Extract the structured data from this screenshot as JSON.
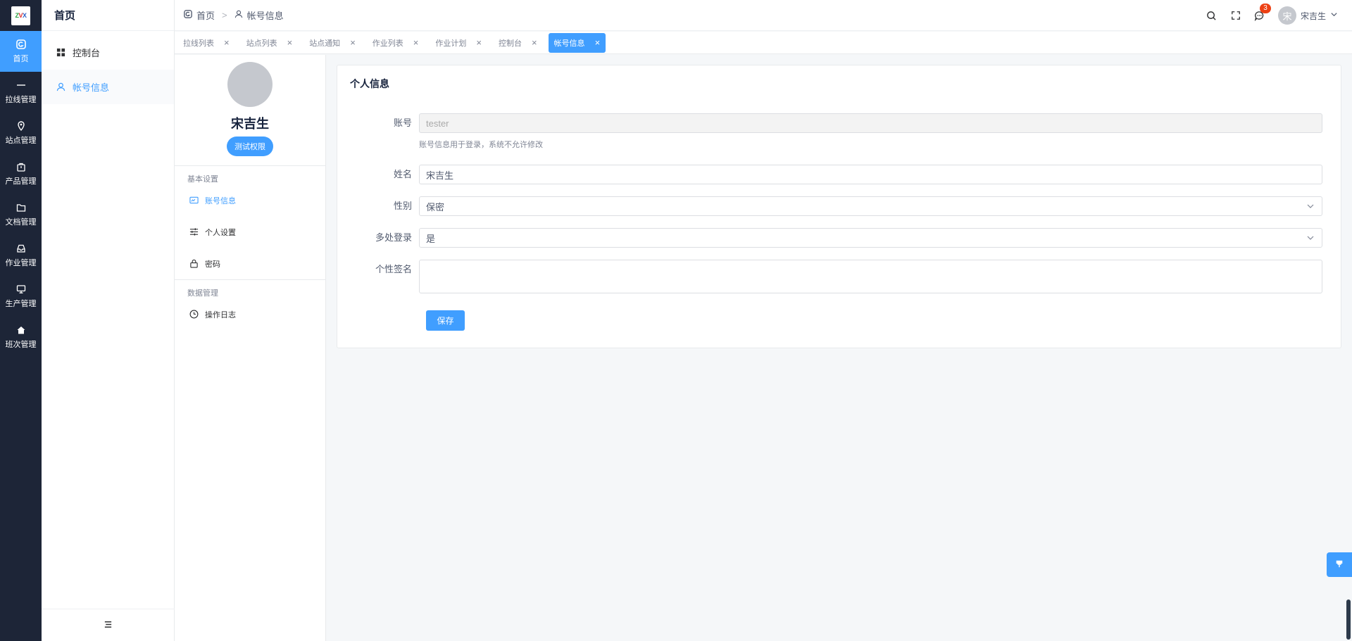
{
  "logo": {
    "letters": [
      "Z",
      "V",
      "X"
    ]
  },
  "rail": [
    {
      "label": "首页",
      "icon": "home-dashboard-icon",
      "active": true
    },
    {
      "label": "拉线管理",
      "icon": "line-icon"
    },
    {
      "label": "站点管理",
      "icon": "location-pin-icon"
    },
    {
      "label": "产品管理",
      "icon": "bag-icon"
    },
    {
      "label": "文档管理",
      "icon": "folder-icon"
    },
    {
      "label": "作业管理",
      "icon": "inbox-icon"
    },
    {
      "label": "生产管理",
      "icon": "monitor-icon"
    },
    {
      "label": "班次管理",
      "icon": "house-icon"
    }
  ],
  "sidebar": {
    "title": "首页",
    "items": [
      {
        "label": "控制台",
        "icon": "grid-icon"
      },
      {
        "label": "帐号信息",
        "icon": "user-icon",
        "active": true
      }
    ]
  },
  "breadcrumb": {
    "home": "首页",
    "current": "帐号信息"
  },
  "header": {
    "badge_count": "3",
    "user_name": "宋吉生",
    "avatar_char": "宋"
  },
  "tabs": [
    {
      "label": "拉线列表"
    },
    {
      "label": "站点列表"
    },
    {
      "label": "站点通知"
    },
    {
      "label": "作业列表"
    },
    {
      "label": "作业计划"
    },
    {
      "label": "控制台"
    },
    {
      "label": "帐号信息",
      "active": true
    }
  ],
  "profile": {
    "name": "宋吉生",
    "role": "测试权限",
    "group_basic": "基本设置",
    "items_basic": [
      {
        "label": "账号信息",
        "icon": "id-card-icon",
        "active": true
      },
      {
        "label": "个人设置",
        "icon": "sliders-icon"
      },
      {
        "label": "密码",
        "icon": "lock-icon"
      }
    ],
    "group_data": "数据管理",
    "items_data": [
      {
        "label": "操作日志",
        "icon": "clock-icon"
      }
    ]
  },
  "form": {
    "title": "个人信息",
    "account_label": "账号",
    "account_value": "tester",
    "account_hint": "账号信息用于登录，系统不允许修改",
    "name_label": "姓名",
    "name_value": "宋吉生",
    "gender_label": "性别",
    "gender_value": "保密",
    "multi_login_label": "多处登录",
    "multi_login_value": "是",
    "signature_label": "个性签名",
    "signature_value": "",
    "save_label": "保存"
  },
  "colors": {
    "accent": "#409eff",
    "rail_bg": "#1d2537",
    "badge": "#ed4014"
  }
}
